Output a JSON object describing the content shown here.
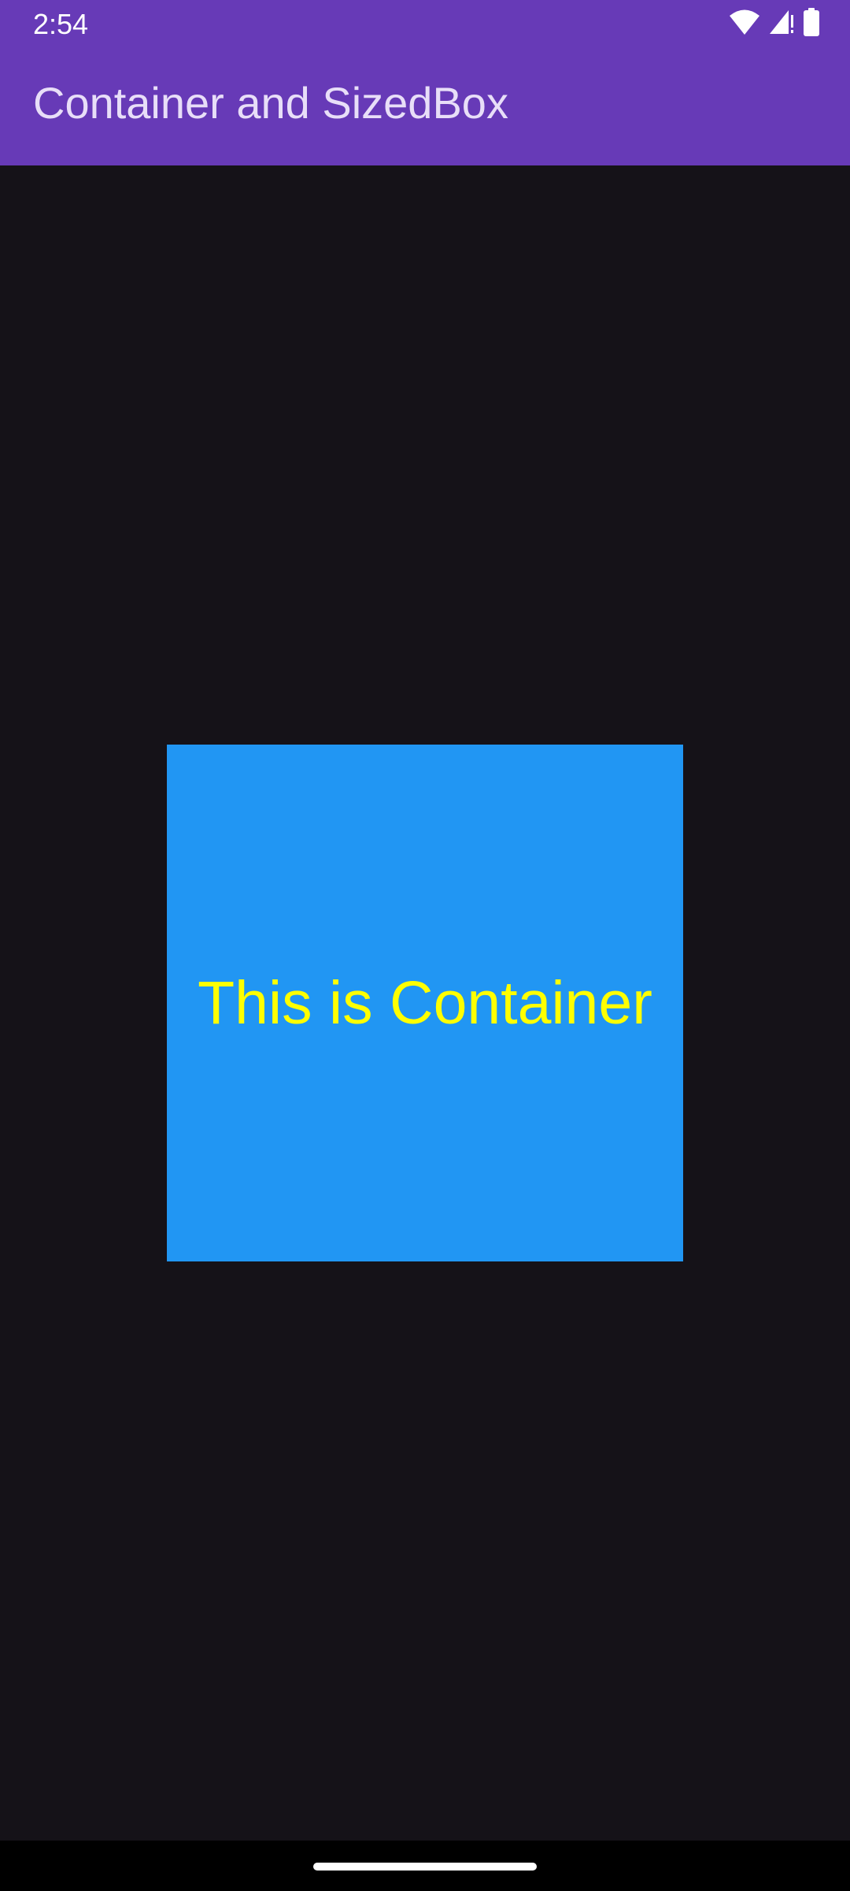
{
  "status_bar": {
    "time": "2:54",
    "icons": [
      "wifi-icon",
      "signal-icon",
      "battery-icon"
    ]
  },
  "app_bar": {
    "title": "Container and SizedBox"
  },
  "container": {
    "text": "This is Container"
  },
  "colors": {
    "app_bar": "#673ab7",
    "background": "#151218",
    "container": "#2196f3",
    "container_text": "#ffff00"
  }
}
